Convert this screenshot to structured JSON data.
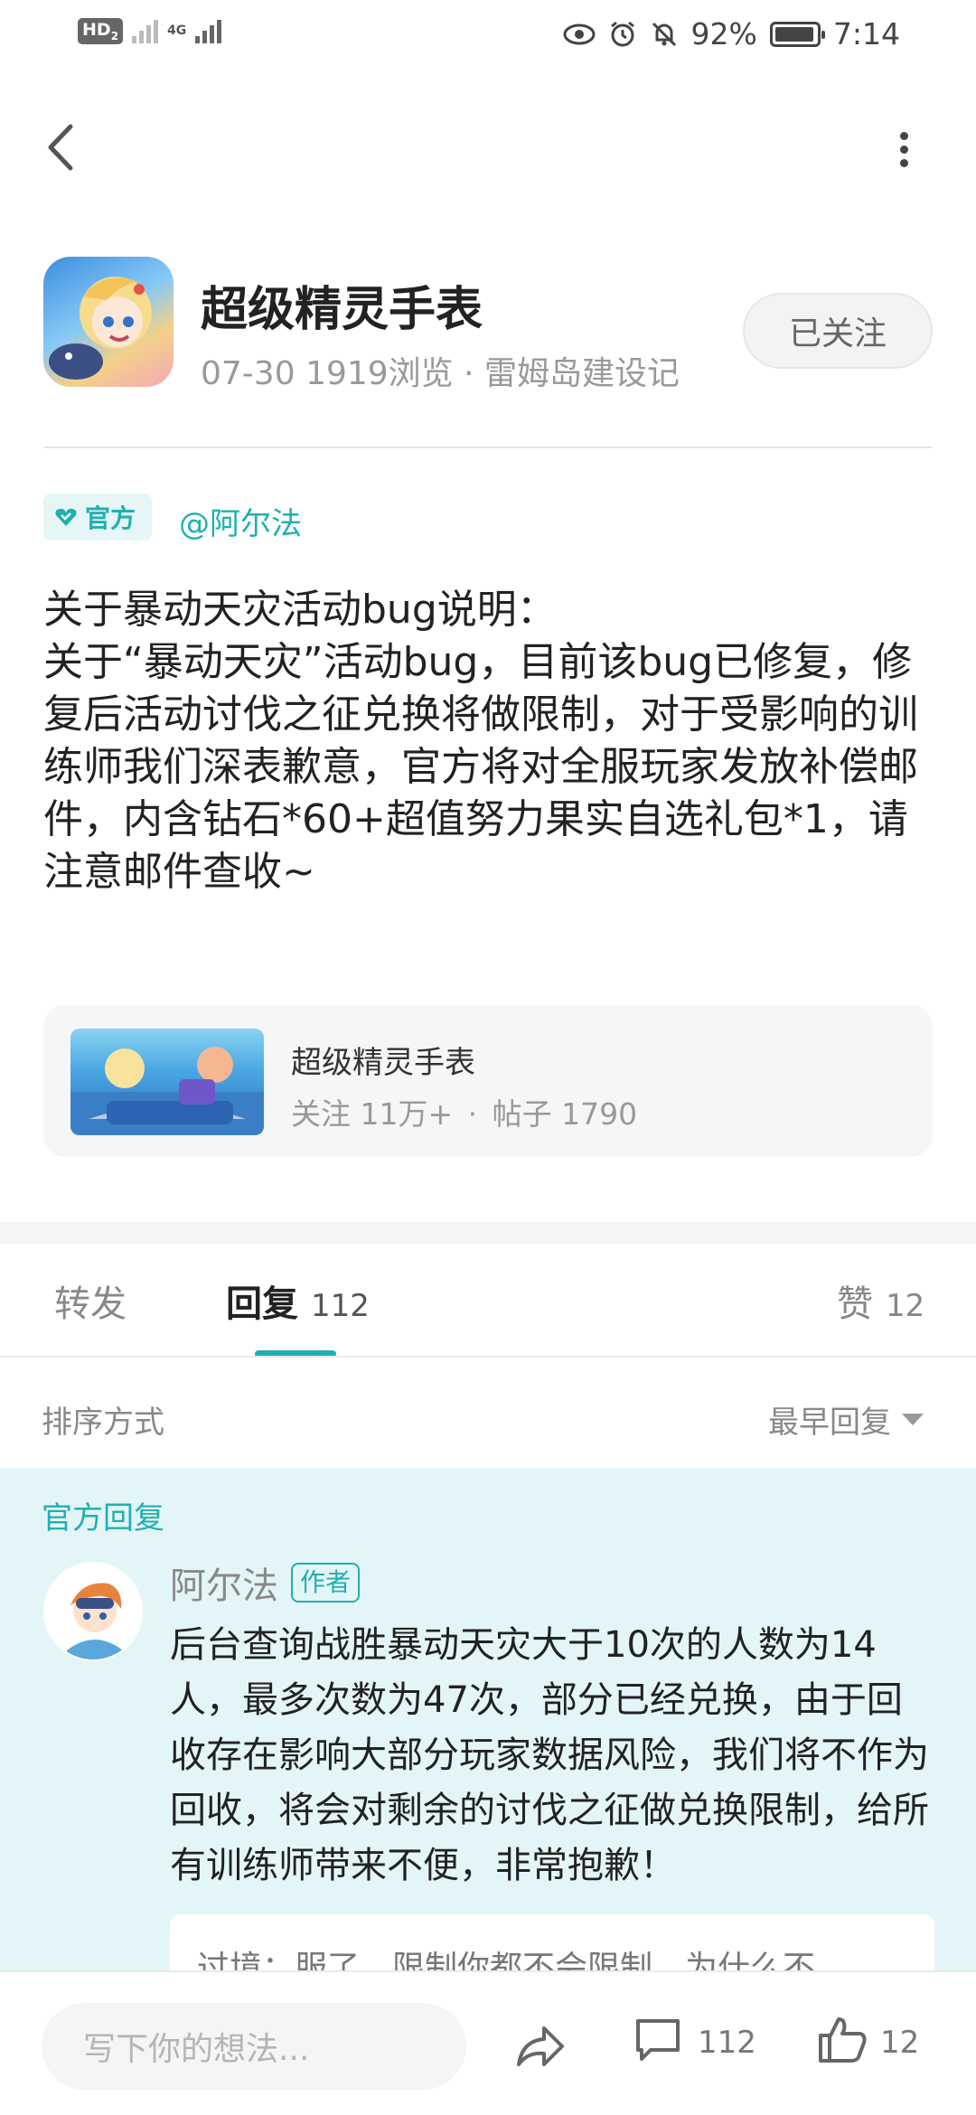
{
  "status_bar": {
    "hd_label": "HD",
    "hd_sub": "2",
    "net_label": "4G",
    "battery": "92%",
    "time": "7:14"
  },
  "post": {
    "app_name": "超级精灵手表",
    "date": "07-30",
    "views": "1919浏览",
    "separator": "·",
    "board": "雷姆岛建设记",
    "follow_label": "已关注",
    "official_badge": "官方",
    "mention": "@阿尔法",
    "body_lines": [
      "关于暴动天灾活动bug说明：",
      "关于“暴动天灾”活动bug，目前该bug已修复，修复后活动讨伐之征兑换将做限制，对于受影响的训练师我们深表歉意，官方将对全服玩家发放补偿邮件，内含钻石*60+超值努力果实自选礼包*1，请注意邮件查收~"
    ]
  },
  "game_card": {
    "title": "超级精灵手表",
    "follow_count": "关注 11万+",
    "separator": "·",
    "post_count": "帖子 1790"
  },
  "tabs": {
    "forward": "转发",
    "reply": "回复",
    "reply_count": "112",
    "like": "赞",
    "like_count": "12"
  },
  "sort": {
    "label": "排序方式",
    "value": "最早回复"
  },
  "official_reply": {
    "section_label": "官方回复",
    "name": "阿尔法",
    "author_tag": "作者",
    "text": "后台查询战胜暴动天灾大于10次的人数为14人，最多次数为47次，部分已经兑换，由于回收存在影响大部分玩家数据风险，我们将不作为回收，将会对剩余的讨伐之征做兑换限制，给所有训练师带来不便，非常抱歉！",
    "quote_partial": "过境：服了，限制你都不会限制，为什么不"
  },
  "bottom_bar": {
    "placeholder": "写下你的想法...",
    "comment_count": "112",
    "like_count": "12"
  },
  "colors": {
    "accent": "#1fb0b0",
    "reply_bg": "#e4f5f7"
  }
}
